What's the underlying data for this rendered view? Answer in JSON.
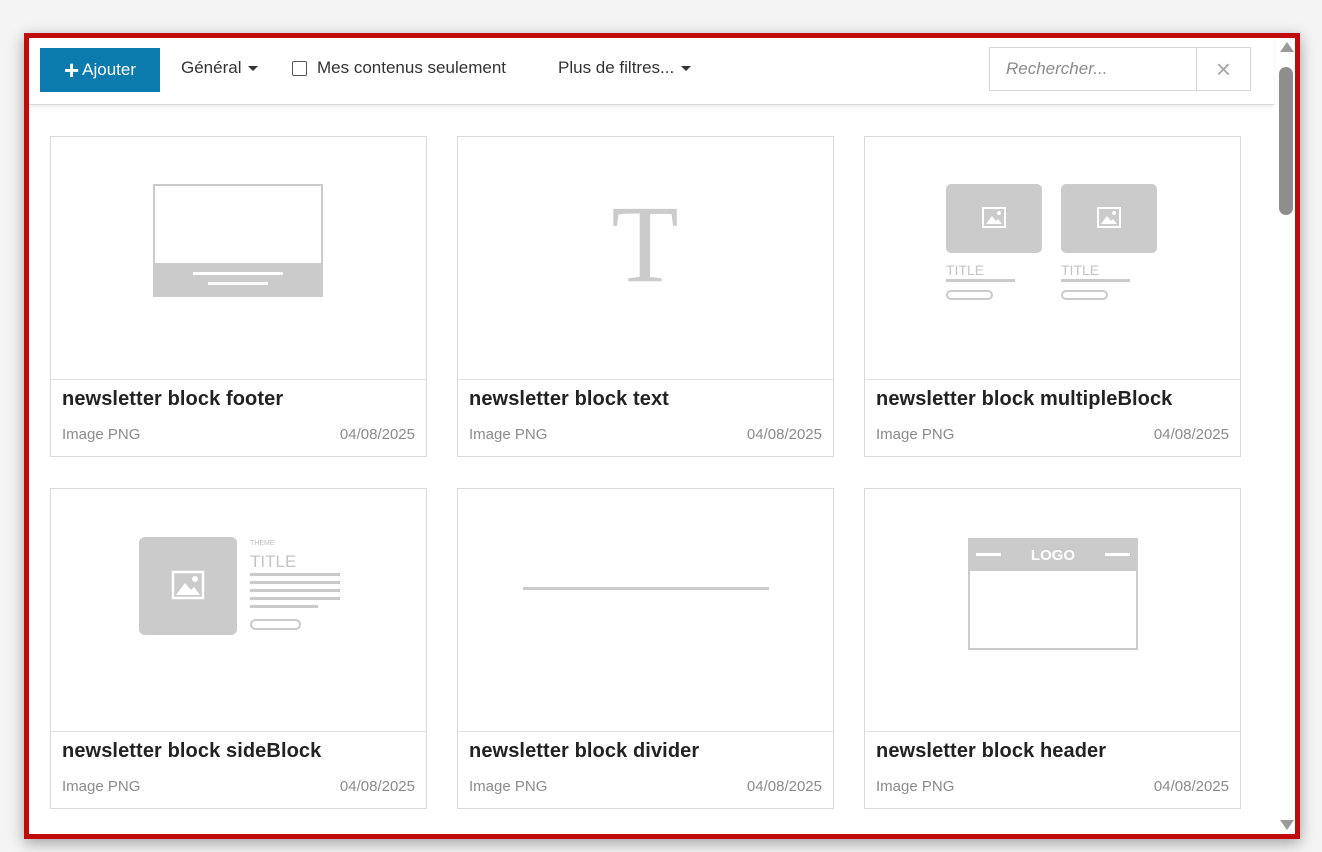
{
  "toolbar": {
    "add_label": "Ajouter",
    "general_label": "Général",
    "my_content_label": "Mes contenus seulement",
    "more_filters_label": "Plus de filtres...",
    "search_placeholder": "Rechercher...",
    "clear_icon": "×"
  },
  "cards": [
    {
      "title": "newsletter block footer",
      "type": "Image PNG",
      "date": "04/08/2025",
      "preview": "footer"
    },
    {
      "title": "newsletter block text",
      "type": "Image PNG",
      "date": "04/08/2025",
      "preview": "text",
      "glyph": "T"
    },
    {
      "title": "newsletter block multipleBlock",
      "type": "Image PNG",
      "date": "04/08/2025",
      "preview": "multiple",
      "labels": [
        "TITLE",
        "TITLE"
      ]
    },
    {
      "title": "newsletter block sideBlock",
      "type": "Image PNG",
      "date": "04/08/2025",
      "preview": "side",
      "theme": "THEME",
      "label": "TITLE"
    },
    {
      "title": "newsletter block divider",
      "type": "Image PNG",
      "date": "04/08/2025",
      "preview": "divider"
    },
    {
      "title": "newsletter block header",
      "type": "Image PNG",
      "date": "04/08/2025",
      "preview": "header",
      "logo": "LOGO"
    }
  ],
  "colors": {
    "accent": "#0b7bae",
    "frame": "#c10a0a",
    "placeholder_gray": "#cbcbcb"
  }
}
